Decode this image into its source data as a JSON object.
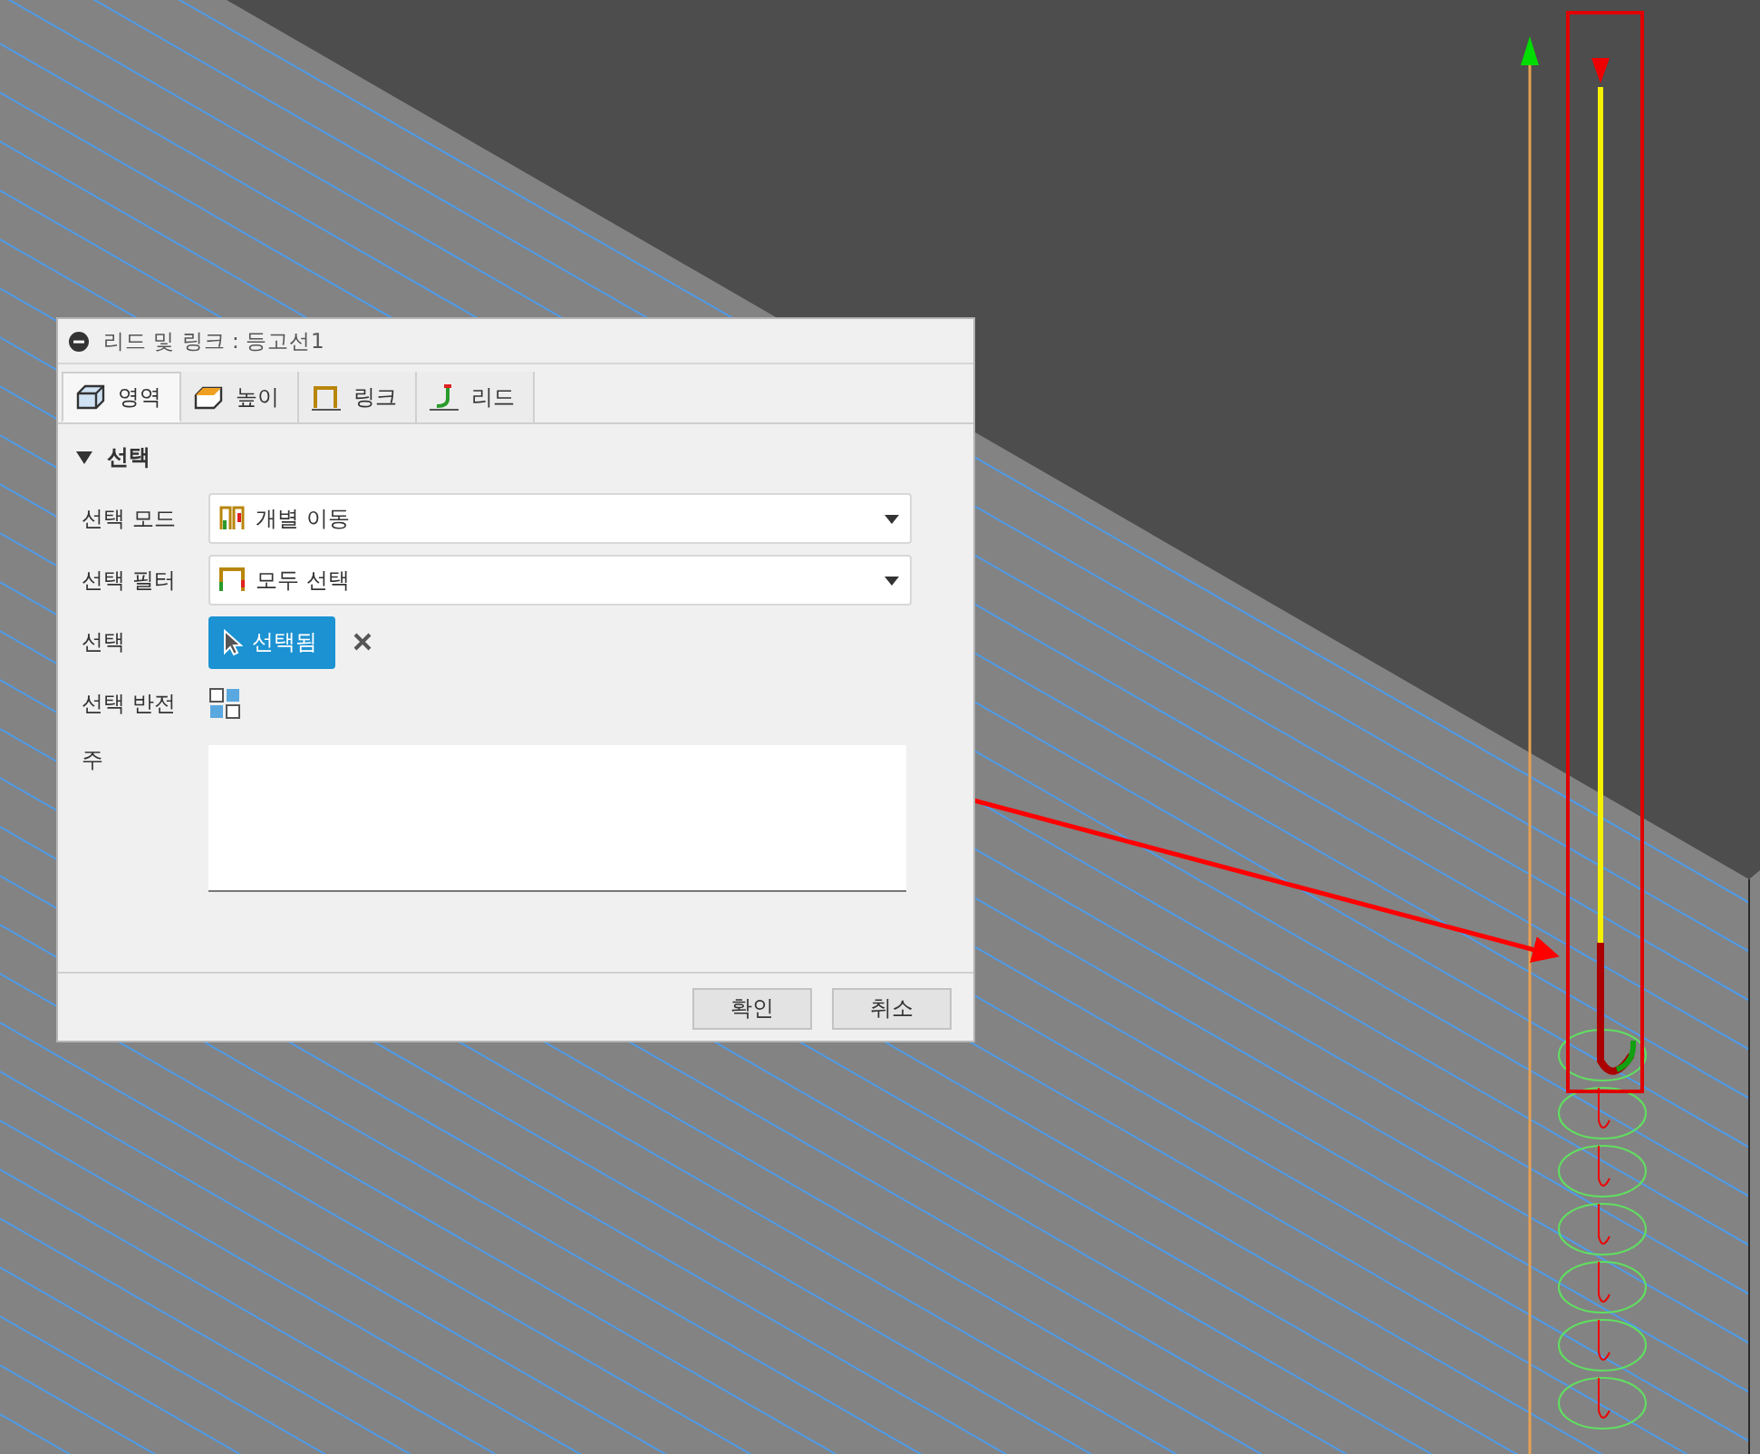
{
  "dialog": {
    "title": "리드 및 링크 : 등고선1",
    "tabs": [
      {
        "label": "영역",
        "selected": true,
        "kind": "area"
      },
      {
        "label": "높이",
        "selected": false,
        "kind": "height"
      },
      {
        "label": "링크",
        "selected": false,
        "kind": "link"
      },
      {
        "label": "리드",
        "selected": false,
        "kind": "lead"
      }
    ],
    "section": {
      "title": "선택",
      "expanded": true
    },
    "fields": [
      {
        "kind": "dropdown",
        "label": "선택 모드",
        "value": "개별 이동"
      },
      {
        "kind": "dropdown",
        "label": "선택 필터",
        "value": "모두 선택"
      },
      {
        "kind": "selection",
        "label": "선택",
        "value": "선택됨",
        "active": true
      },
      {
        "kind": "invert",
        "label": "선택 반전"
      },
      {
        "kind": "note",
        "label": "주"
      }
    ],
    "buttons": [
      "확인",
      "취소"
    ]
  }
}
